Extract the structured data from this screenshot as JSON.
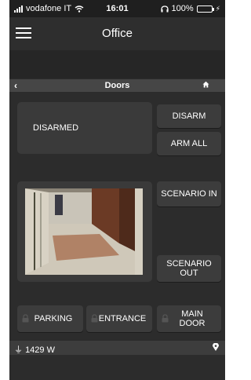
{
  "status_bar": {
    "carrier": "vodafone IT",
    "time": "16:01",
    "battery": "100%",
    "battery_level": 1.0,
    "battery_color": "#4cd964"
  },
  "header": {
    "title": "Office",
    "menu_icon": "hamburger-icon"
  },
  "section": {
    "back_icon": "chevron-left-icon",
    "title": "Doors",
    "home_icon": "home-icon"
  },
  "alarm": {
    "status_text": "DISARMED",
    "disarm_label": "DISARM",
    "arm_all_label": "ARM ALL"
  },
  "scenarios": {
    "in_label": "SCENARIO IN",
    "out_label": "SCENARIO OUT"
  },
  "doors": [
    {
      "label": "PARKING"
    },
    {
      "label": "ENTRANCE"
    },
    {
      "label": "MAIN DOOR"
    }
  ],
  "footer": {
    "power": "1429 W",
    "power_icon": "plug-icon",
    "pin_icon": "location-pin-icon"
  }
}
